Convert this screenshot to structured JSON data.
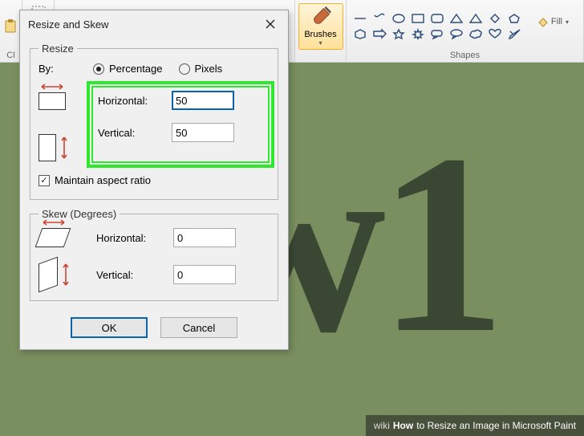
{
  "ribbon": {
    "clipboard_label": "Cl",
    "brushes_label": "Brushes",
    "shapes_label": "Shapes",
    "fill_label": "Fill"
  },
  "dialog": {
    "title": "Resize and Skew",
    "resize": {
      "legend": "Resize",
      "by_label": "By:",
      "percentage_label": "Percentage",
      "pixels_label": "Pixels",
      "resize_by": "percentage",
      "horizontal_label": "Horizontal:",
      "vertical_label": "Vertical:",
      "horizontal_value": "50",
      "vertical_value": "50",
      "maintain_label": "Maintain aspect ratio",
      "maintain_checked": true
    },
    "skew": {
      "legend": "Skew (Degrees)",
      "horizontal_label": "Horizontal:",
      "vertical_label": "Vertical:",
      "horizontal_value": "0",
      "vertical_value": "0"
    },
    "ok_label": "OK",
    "cancel_label": "Cancel"
  },
  "caption": {
    "prefix": "wiki",
    "bold": "How",
    "rest": " to Resize an Image in Microsoft Paint"
  }
}
